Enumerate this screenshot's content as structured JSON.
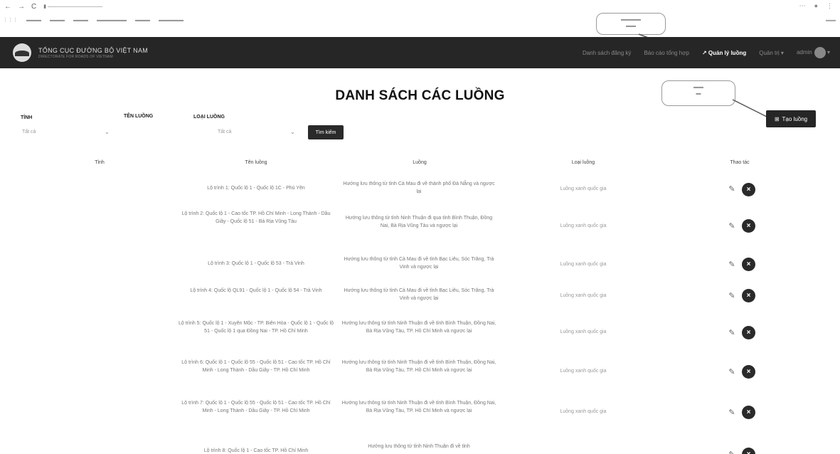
{
  "app": {
    "brand_title": "TỔNG CỤC ĐƯỜNG BỘ VIỆT NAM",
    "brand_subtitle": "DIRECTORATE FOR ROADS OF VIETNAM",
    "menu": [
      "Danh sách đăng ký",
      "Báo cáo tổng hợp",
      "Quản lý luồng",
      "Quản trị",
      "admin"
    ],
    "active_menu": "Quản lý luồng"
  },
  "page": {
    "title": "DANH SÁCH CÁC LUỒNG",
    "create_button": "Tạo luồng"
  },
  "filters": {
    "province_label": "TỈNH",
    "province_value": "Tất cả",
    "route_name_label": "TÊN LUỒNG",
    "route_type_label": "LOẠI LUỒNG",
    "route_type_value": "Tất cả",
    "search_button": "Tìm kiếm"
  },
  "table": {
    "headers": [
      "Tỉnh",
      "Tên luồng",
      "Luồng",
      "Loại luồng",
      "Thao tác"
    ],
    "rows": [
      {
        "name": "Lộ trình 1: Quốc lộ 1 - Quốc lộ 1C - Phú Yên",
        "desc": "Hướng lưu thông từ tỉnh Cà Mau đi về thành phố Đà Nẵng và ngược lại",
        "type": "Luồng xanh quốc gia"
      },
      {
        "name": "Lộ trình 2: Quốc lộ 1 - Cao tốc TP. Hồ Chí Minh - Long Thành - Dầu Giây - Quốc lộ 51 - Bà Rịa Vũng Tàu",
        "desc": "Hướng lưu thông từ tỉnh Ninh Thuận đi qua tỉnh Bình Thuận, Đồng Nai, Bà Rịa Vũng Tàu và ngược lại",
        "type": "Luồng xanh quốc gia"
      },
      {
        "name": "Lộ trình 3: Quốc lộ 1 - Quốc lộ 53 - Trà Vinh",
        "desc": "Hướng lưu thông từ tỉnh Cà Mau đi về tỉnh Bạc Liêu, Sóc Trăng, Trà Vinh và ngược lại",
        "type": "Luồng xanh quốc gia"
      },
      {
        "name": "Lộ trình 4: Quốc lộ QL91 - Quốc lộ 1 - Quốc lộ 54 - Trà Vinh",
        "desc": "Hướng lưu thông từ tỉnh Cà Mau đi về tỉnh Bạc Liêu, Sóc Trăng, Trà Vinh và ngược lại",
        "type": "Luồng xanh quốc gia"
      },
      {
        "name": "Lộ trình 5: Quốc lộ 1 - Xuyên Mộc - TP. Biên Hòa - Quốc lộ 1 - Quốc lộ 51 - Quốc lộ 1 qua Đồng Nai - TP. Hồ Chí Minh",
        "desc": "Hướng lưu thông từ tỉnh Ninh Thuận đi về tỉnh Bình Thuận, Đồng Nai, Bà Rịa Vũng Tàu, TP. Hồ Chí Minh và ngược lại",
        "type": "Luồng xanh quốc gia"
      },
      {
        "name": "Lộ trình 6: Quốc lộ 1 - Quốc lộ 55 - Quốc lộ 51 - Cao tốc TP. Hồ Chí Minh - Long Thành - Dầu Giây - TP. Hồ Chí Minh",
        "desc": "Hướng lưu thông từ tỉnh Ninh Thuận đi về tỉnh Bình Thuận, Đồng Nai, Bà Rịa Vũng Tàu, TP. Hồ Chí Minh và ngược lại",
        "type": "Luồng xanh quốc gia"
      },
      {
        "name": "Lộ trình 7: Quốc lộ 1 - Quốc lộ 55 - Quốc lộ 51 - Cao tốc TP. Hồ Chí Minh - Long Thành - Dầu Giây - TP. Hồ Chí Minh",
        "desc": "Hướng lưu thông từ tỉnh Ninh Thuận đi về tỉnh Bình Thuận, Đồng Nai, Bà Rịa Vũng Tàu, TP. Hồ Chí Minh và ngược lại",
        "type": "Luồng xanh quốc gia"
      },
      {
        "name": "Lộ trình 8: Quốc lộ 1 - Cao tốc TP. Hồ Chí Minh",
        "desc": "Hướng lưu thông từ tỉnh Ninh Thuận đi về tỉnh",
        "type": ""
      }
    ]
  }
}
